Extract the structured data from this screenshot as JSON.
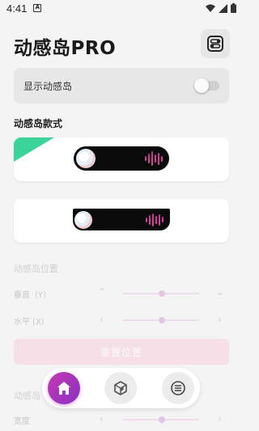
{
  "status_bar": {
    "time": "4:41",
    "notification_icon": "a-icon",
    "icons": [
      "wifi-icon",
      "signal-icon",
      "battery-icon"
    ]
  },
  "header": {
    "title": "动感岛PRO",
    "menu_icon": "toggles-icon"
  },
  "show_island": {
    "label": "显示动感岛",
    "enabled": false
  },
  "styles": {
    "title": "动感岛款式",
    "items": [
      {
        "shape": "pill",
        "selected": true,
        "badge_color": "#3ad39a"
      },
      {
        "shape": "notch",
        "selected": false
      }
    ]
  },
  "position": {
    "title": "动感岛位置",
    "vertical_label": "垂直（Y）",
    "horizontal_label": "水平 (X)",
    "vertical_value": 0.52,
    "horizontal_value": 0.52,
    "reset_label": "重置位置"
  },
  "size": {
    "title": "动感岛",
    "width_label": "宽度",
    "width_value": 0.52
  },
  "bottom_nav": {
    "items": [
      {
        "name": "home",
        "icon": "home-icon",
        "active": true
      },
      {
        "name": "plugins",
        "icon": "cube-icon",
        "active": false
      },
      {
        "name": "menu",
        "icon": "list-icon",
        "active": false
      }
    ]
  },
  "colors": {
    "accent": "#b534b4",
    "wave": "#d13d9a",
    "badge": "#3ad39a",
    "reset_disabled": "#f6dfe7"
  }
}
